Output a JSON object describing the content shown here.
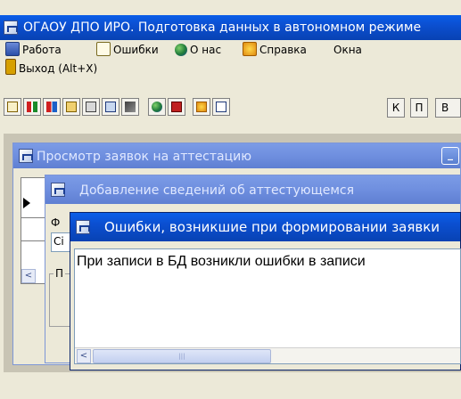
{
  "app": {
    "title": "ОГАОУ ДПО ИРО. Подготовка данных в автономном режиме"
  },
  "menu": {
    "items": [
      {
        "label": "Работа",
        "icon": "work-icon"
      },
      {
        "label": "Ошибки",
        "icon": "errors-icon"
      },
      {
        "label": "О нас",
        "icon": "globe-icon"
      },
      {
        "label": "Справка",
        "icon": "help-icon"
      },
      {
        "label": "Окна",
        "icon": ""
      }
    ],
    "exit_label": "Выход (Alt+X)"
  },
  "toolbar": {
    "letters": [
      "К",
      "П",
      "В"
    ]
  },
  "windows": {
    "requests": {
      "title": "Просмотр заявок на аттестацию",
      "min_label": "_"
    },
    "add_info": {
      "title": "Добавление сведений об аттестующемся",
      "label_f": "Ф",
      "field_prefix": "Сі",
      "group_label": "П"
    },
    "errors": {
      "title": "Ошибки, возникшие при формировании заявки",
      "message": "При записи в БД возникли ошибки в записи",
      "scroll_mark": "|||"
    }
  },
  "colors": {
    "title_active": "#0b55e0",
    "title_inactive": "#7b96dd",
    "face": "#ece9d8"
  }
}
